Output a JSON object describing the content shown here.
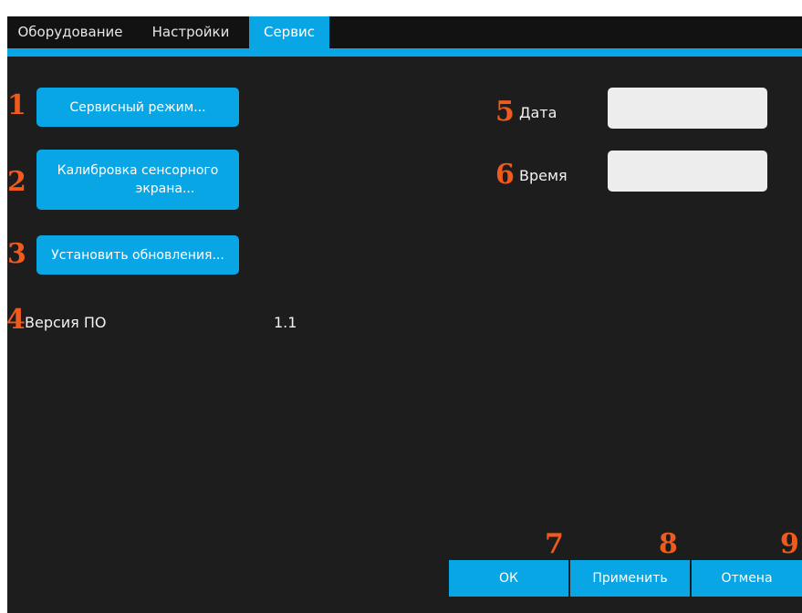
{
  "tabs": [
    {
      "label": "Оборудование",
      "active": false
    },
    {
      "label": "Настройки",
      "active": false
    },
    {
      "label": "Сервис",
      "active": true
    }
  ],
  "service": {
    "service_mode_button": "Сервисный режим...",
    "calibration_button_line1": "Калибровка сенсорного",
    "calibration_button_line2": "экрана...",
    "install_updates_button": "Установить обновления...",
    "version_label": "Версия ПО",
    "version_value": "1.1"
  },
  "datetime": {
    "date_label": "Дата",
    "date_value": "",
    "time_label": "Время",
    "time_value": ""
  },
  "footer": {
    "ok_label": "ОК",
    "apply_label": "Применить",
    "cancel_label": "Отмена"
  },
  "markers": [
    "1",
    "2",
    "3",
    "4",
    "5",
    "6",
    "7",
    "8",
    "9"
  ],
  "colors": {
    "accent": "#09a6e6",
    "background": "#1d1d1d",
    "tabbar": "#121212",
    "marker": "#f05a1c",
    "field": "#ededed"
  }
}
